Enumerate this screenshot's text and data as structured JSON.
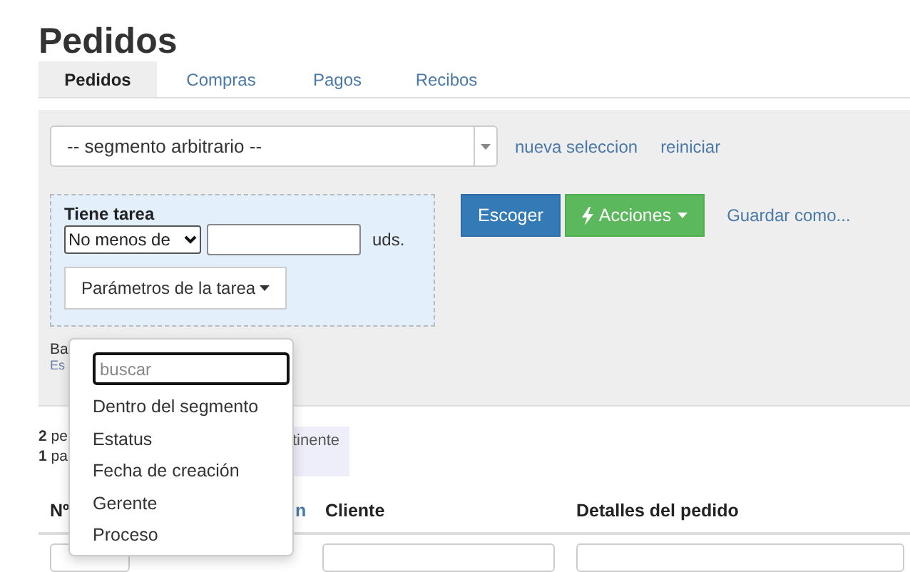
{
  "title": "Pedidos",
  "tabs": [
    {
      "label": "Pedidos",
      "selected": true
    },
    {
      "label": "Compras",
      "selected": false
    },
    {
      "label": "Pagos",
      "selected": false
    },
    {
      "label": "Recibos",
      "selected": false
    }
  ],
  "segment_select": {
    "value": "-- segmento arbitrario --"
  },
  "segment_links": [
    "nueva seleccion",
    "reiniciar"
  ],
  "filter": {
    "title": "Tiene tarea",
    "operator": "No menos de",
    "unit": "uds.",
    "params_button": "Parámetros de la tarea"
  },
  "actions": {
    "choose": "Escoger",
    "actions": "Acciones",
    "save_as": "Guardar como..."
  },
  "below_filter": {
    "line_1": "Ba",
    "line_2": "Es"
  },
  "summary": [
    {
      "count": "2",
      "text": "pe"
    },
    {
      "count": "1",
      "text": "pa"
    }
  ],
  "note": "tinente",
  "table": {
    "columns": [
      {
        "label": "Nº",
        "kind": "plain"
      },
      {
        "label": "n",
        "kind": "link"
      },
      {
        "label": "Cliente",
        "kind": "plain"
      },
      {
        "label": "Detalles del pedido",
        "kind": "plain"
      }
    ]
  },
  "dropdown": {
    "search_placeholder": "buscar",
    "items": [
      "Dentro del segmento",
      "Estatus",
      "Fecha de creación",
      "Gerente",
      "Proceso"
    ]
  }
}
